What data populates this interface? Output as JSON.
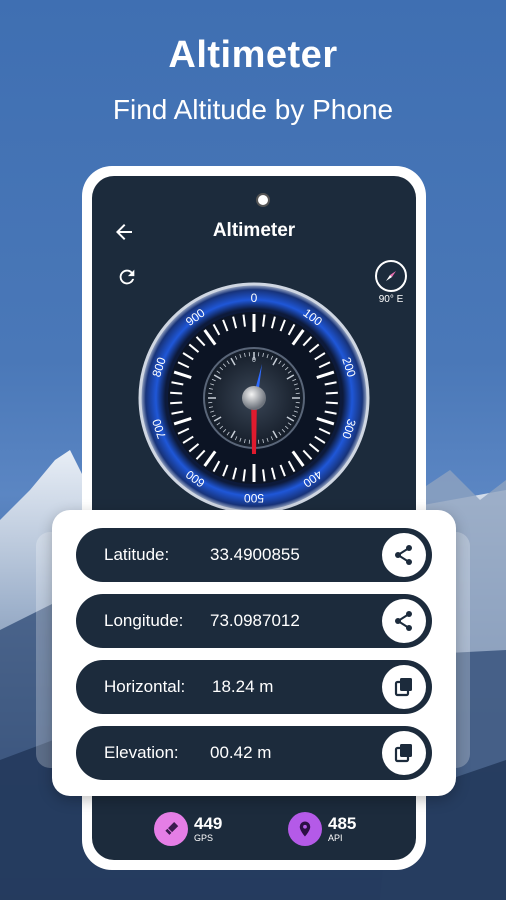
{
  "promo": {
    "title": "Altimeter",
    "subtitle": "Find Altitude by Phone"
  },
  "app": {
    "title": "Altimeter",
    "compass_label": "90° E",
    "gauge_labels": [
      "0",
      "100",
      "200",
      "300",
      "400",
      "500",
      "600",
      "700",
      "800",
      "900"
    ],
    "inner_dial_labels": [
      "0",
      "5"
    ],
    "needle_color": "#e01b2e",
    "accent_color": "#1f57d8"
  },
  "info": {
    "rows": [
      {
        "label": "Latitude:",
        "value": "33.4900855",
        "action_icon": "share-icon"
      },
      {
        "label": "Longitude:",
        "value": "73.0987012",
        "action_icon": "share-icon"
      },
      {
        "label": "Horizontal:",
        "value": "18.24 m",
        "action_icon": "copy-icon"
      },
      {
        "label": "Elevation:",
        "value": "00.42 m",
        "action_icon": "copy-icon"
      }
    ]
  },
  "stats": {
    "gps": {
      "value": "449",
      "label": "GPS",
      "color": "#e57ee6"
    },
    "api": {
      "value": "485",
      "label": "API",
      "color": "#b45ae8"
    }
  }
}
